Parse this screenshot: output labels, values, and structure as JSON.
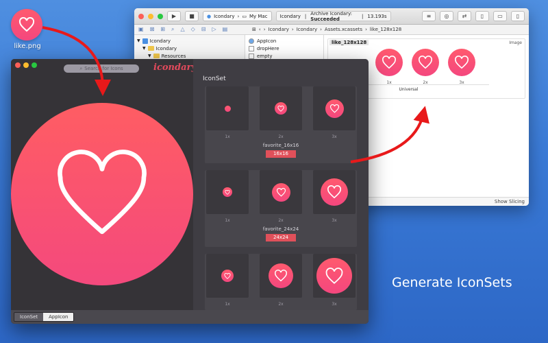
{
  "desktop": {
    "file_label": "like.png",
    "icon": "heart-icon"
  },
  "tagline": "Generate IconSets",
  "colors": {
    "accent": "#e0505a",
    "heart_top": "#ff5d63",
    "heart_bottom": "#f4497d",
    "desktop": "#3a7ad6"
  },
  "xcode": {
    "scheme": "Icondary",
    "destination": "My Mac",
    "status_project": "Icondary",
    "status_action": "Archive Icondary:",
    "status_result": "Succeeded",
    "status_time": "13.193s",
    "breadcrumbs": [
      "Icondary",
      "Icondary",
      "Assets.xcassets",
      "like_128x128"
    ],
    "navigator": [
      {
        "label": "Icondary",
        "kind": "project",
        "indent": 0
      },
      {
        "label": "Icondary",
        "kind": "folder",
        "indent": 1
      },
      {
        "label": "Resources",
        "kind": "folder",
        "indent": 2
      }
    ],
    "assets": [
      "AppIcon",
      "dropHere",
      "empty"
    ],
    "image_set": {
      "name": "like_128x128",
      "type": "Image",
      "slots": [
        "1x",
        "2x",
        "3x"
      ],
      "idiom": "Universal"
    },
    "bottom_right": "Show Slicing"
  },
  "icondary": {
    "search_placeholder": "Search for Icons",
    "logo": "icondary",
    "section_title": "IconSet",
    "groups": [
      {
        "name": "favorite_16x16",
        "badge": "16x16",
        "scales": [
          "1x",
          "2x",
          "3x"
        ]
      },
      {
        "name": "favorite_24x24",
        "badge": "24x24",
        "scales": [
          "1x",
          "2x",
          "3x"
        ]
      },
      {
        "name": "",
        "badge": "",
        "scales": [
          "1x",
          "2x",
          "3x"
        ]
      }
    ],
    "tabs": [
      {
        "label": "IconSet",
        "active": false
      },
      {
        "label": "AppIcon",
        "active": true
      }
    ]
  }
}
